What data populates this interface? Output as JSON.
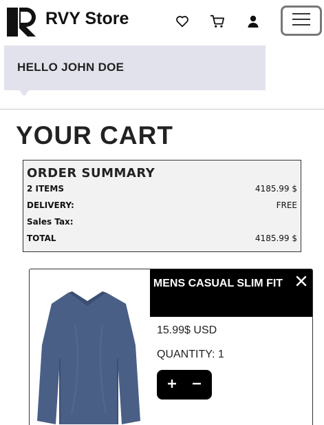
{
  "header": {
    "brand": "RVY Store",
    "logo_icon": "rvy-logo",
    "icons": [
      "heart-icon",
      "cart-icon",
      "user-icon",
      "hamburger-menu-icon"
    ]
  },
  "greeting": {
    "text": "HELLO JOHN DOE"
  },
  "page": {
    "title": "YOUR CART"
  },
  "summary": {
    "title": "ORDER SUMMARY",
    "rows": [
      {
        "label": "2 ITEMS",
        "value": "4185.99 $"
      },
      {
        "label": "DELIVERY:",
        "value": "FREE"
      },
      {
        "label": "Sales Tax:",
        "value": ""
      },
      {
        "label": "TOTAL",
        "value": "4185.99 $"
      }
    ]
  },
  "cart_items": [
    {
      "name": "MENS CASUAL SLIM FIT",
      "price": "15.99$ USD",
      "quantity": "QUANTITY: 1",
      "image": "blue-long-sleeve-shirt"
    }
  ],
  "colors": {
    "greeting_bg": "#e2e2ec",
    "summary_bg": "#f2f2f2",
    "product_head_bg": "#000000",
    "shirt": "#4a5f86"
  }
}
